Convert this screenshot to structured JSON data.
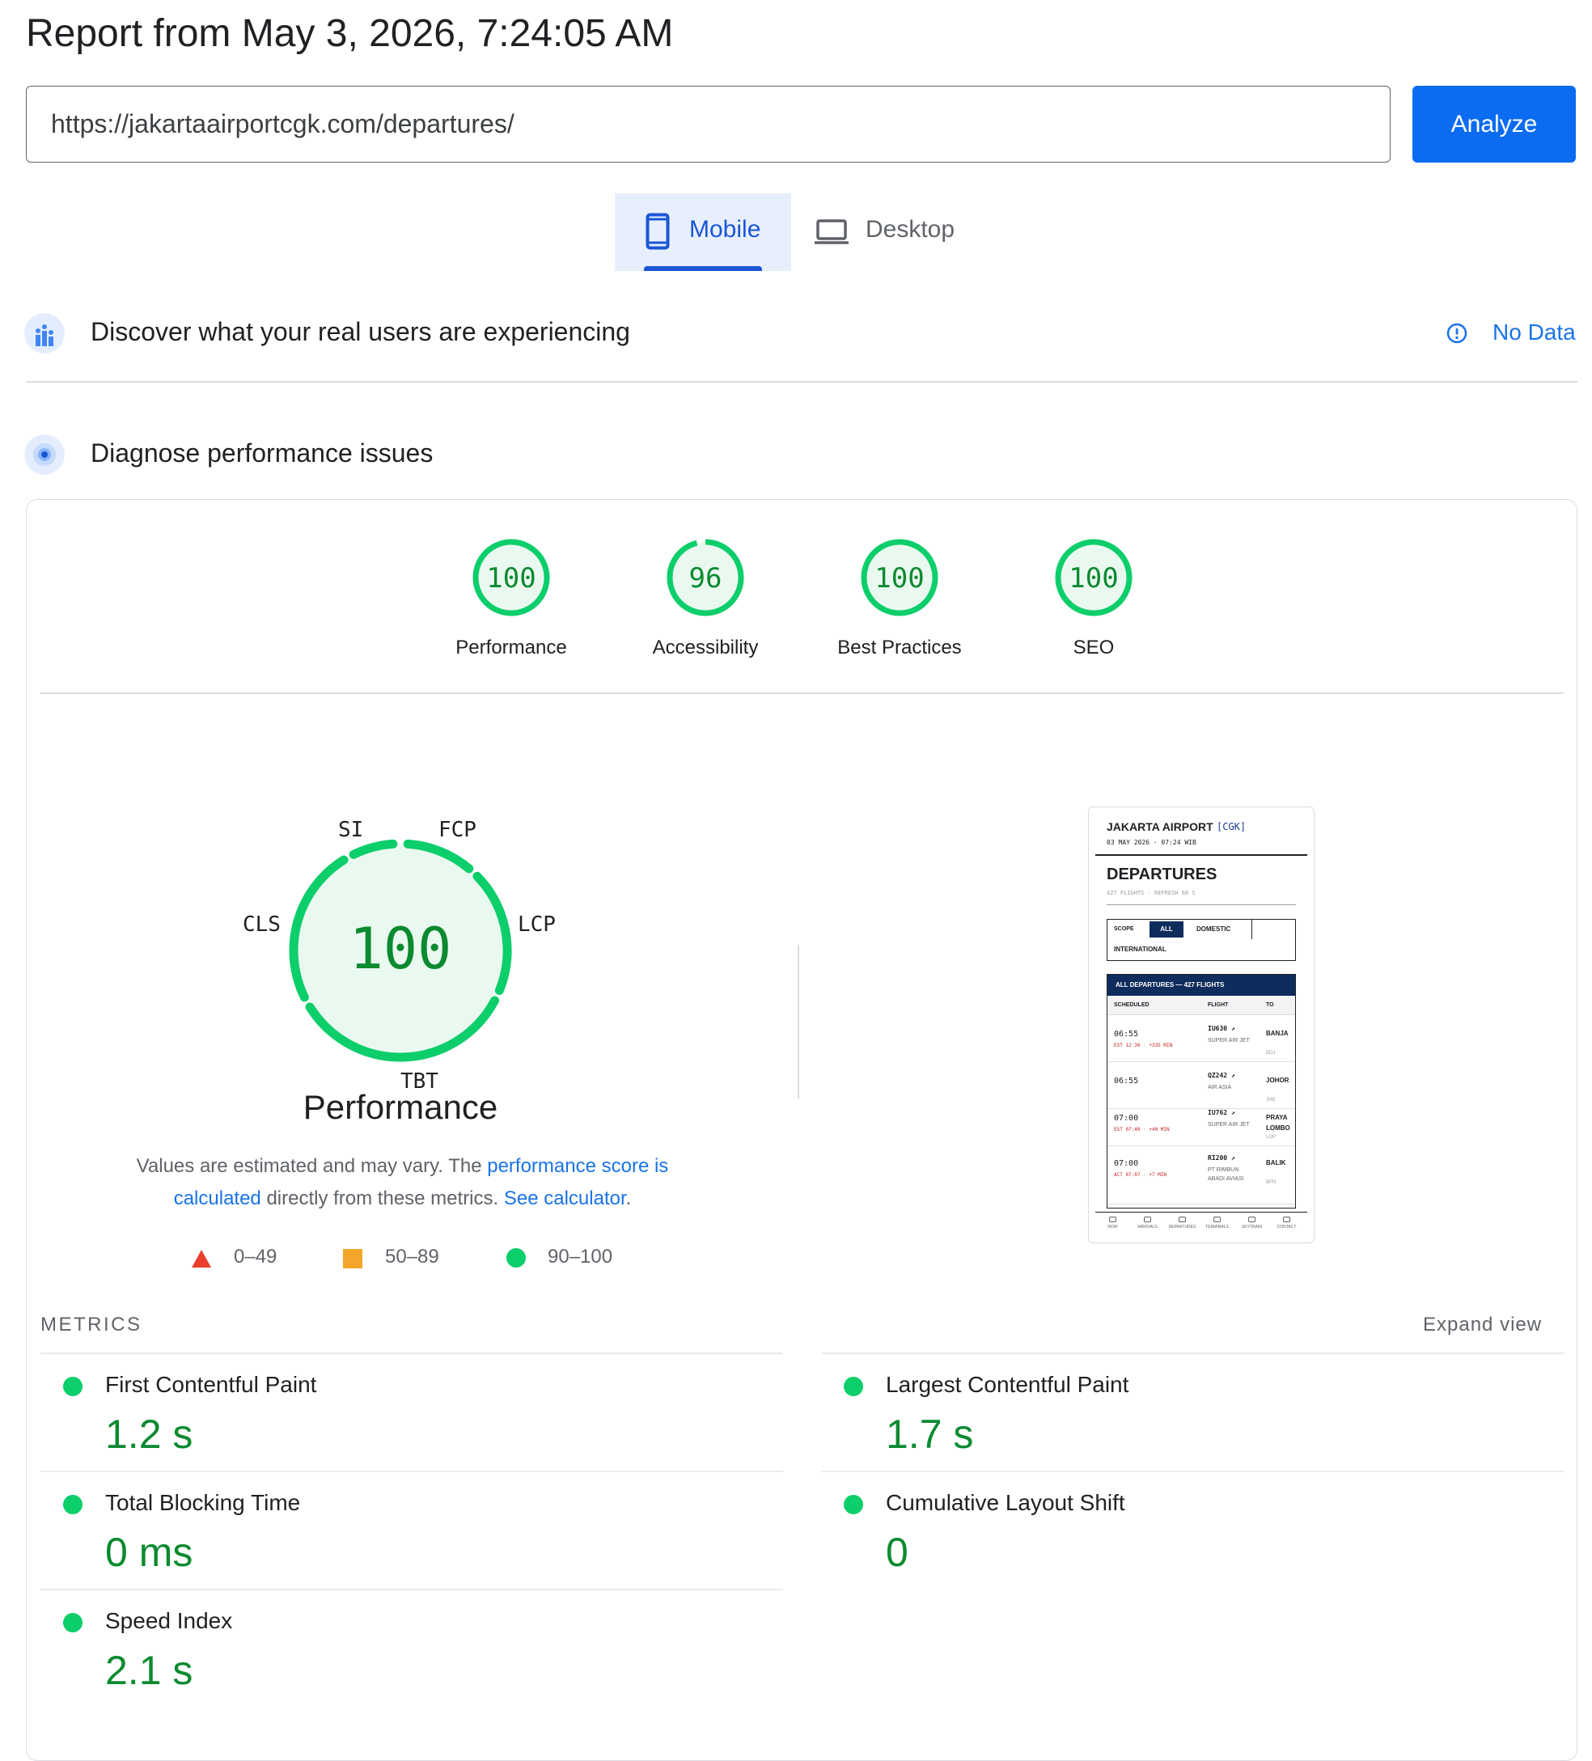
{
  "report_title": "Report from May 3, 2026, 7:24:05 AM",
  "url_input": {
    "value": "https://jakartaairportcgk.com/departures/"
  },
  "analyze_label": "Analyze",
  "tabs": {
    "mobile": "Mobile",
    "desktop": "Desktop",
    "selected": "Mobile"
  },
  "field_section": {
    "title": "Discover what your real users are experiencing",
    "status": "No Data"
  },
  "lab_section": {
    "title": "Diagnose performance issues"
  },
  "scores": [
    {
      "label": "Performance",
      "value": "100",
      "fraction": 1.0
    },
    {
      "label": "Accessibility",
      "value": "96",
      "fraction": 0.96
    },
    {
      "label": "Best Practices",
      "value": "100",
      "fraction": 1.0
    },
    {
      "label": "SEO",
      "value": "100",
      "fraction": 1.0
    }
  ],
  "perf_gauge": {
    "value": "100",
    "label": "Performance",
    "segment_labels": {
      "si": "SI",
      "fcp": "FCP",
      "lcp": "LCP",
      "tbt": "TBT",
      "cls": "CLS"
    }
  },
  "note": {
    "text1": "Values are estimated and may vary. The ",
    "link1": "performance score is calculated",
    "text2": " directly from these metrics. ",
    "link2": "See calculator",
    "text3": "."
  },
  "legend": [
    {
      "range": "0–49",
      "color": "#e8402d"
    },
    {
      "range": "50–89",
      "color": "#f4a62a"
    },
    {
      "range": "90–100",
      "color": "#0cce6b"
    }
  ],
  "metrics_header": "METRICS",
  "expand_view": "Expand view",
  "metrics": [
    {
      "name": "First Contentful Paint",
      "value": "1.2 s"
    },
    {
      "name": "Largest Contentful Paint",
      "value": "1.7 s"
    },
    {
      "name": "Total Blocking Time",
      "value": "0 ms"
    },
    {
      "name": "Cumulative Layout Shift",
      "value": "0"
    },
    {
      "name": "Speed Index",
      "value": "2.1 s"
    }
  ],
  "thumbnail": {
    "brand": "JAKARTA AIRPORT",
    "code": "[CGK]",
    "date": "03 MAY 2026 · 07:24 WIB",
    "heading": "DEPARTURES",
    "sub": "427 FLIGHTS · REFRESH 60 S",
    "scope": "SCOPE",
    "filters": [
      "ALL",
      "DOMESTIC",
      "INTERNATIONAL"
    ],
    "table_title": "ALL DEPARTURES — 427 FLIGHTS",
    "columns": [
      "SCHEDULED",
      "FLIGHT",
      "TO"
    ],
    "rows": [
      {
        "time": "06:55",
        "est": "EST 12:30 · +335 MIN",
        "flight": "IU630 ↗",
        "airline": "SUPER AIR JET",
        "to": "BANJA",
        "code": "BDJ"
      },
      {
        "time": "06:55",
        "est": "",
        "flight": "QZ242 ↗",
        "airline": "AIR ASIA",
        "to": "JOHOR",
        "code": "JHB"
      },
      {
        "time": "07:00",
        "est": "EST 07:40 · +40 MIN",
        "flight": "IU762 ↗",
        "airline": "SUPER AIR JET",
        "to": "PRAYA LOMBO",
        "code": "LOP"
      },
      {
        "time": "07:00",
        "est": "ACT 07:07 · +7 MIN",
        "flight": "RI200 ↗",
        "airline": "PT RIMBUN ABADI AVIASI",
        "to": "BALIK",
        "code": "BPN"
      }
    ],
    "nav": [
      "NOW",
      "ARRIVALS",
      "DEPARTURES",
      "TERMINALS",
      "SKYTRAIN",
      "CONTACT"
    ]
  },
  "colors": {
    "pass": "#0cce6b",
    "pass_text": "#0c8a30",
    "accent": "#0b6cf2",
    "link": "#1a73e8"
  }
}
